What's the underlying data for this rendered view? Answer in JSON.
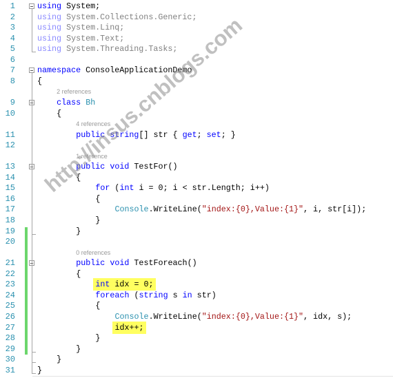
{
  "watermark": "http://insus.cnblogs.com",
  "colors": {
    "keyword": "#0000FF",
    "type": "#2B91AF",
    "string": "#A31515",
    "line_number": "#2B91AF",
    "change_bar": "#6CD66C",
    "highlight": "#FFFF60"
  },
  "rows": [
    {
      "ln": "1",
      "indent": 0,
      "fold": true,
      "seg": [
        [
          "using",
          "kw"
        ],
        [
          " System;",
          "pl"
        ]
      ]
    },
    {
      "ln": "2",
      "indent": 0,
      "seg": [
        [
          "using",
          "dkw"
        ],
        [
          " System.Collections.Generic;",
          "dpl"
        ]
      ]
    },
    {
      "ln": "3",
      "indent": 0,
      "seg": [
        [
          "using",
          "dkw"
        ],
        [
          " System.Linq;",
          "dpl"
        ]
      ]
    },
    {
      "ln": "4",
      "indent": 0,
      "seg": [
        [
          "using",
          "dkw"
        ],
        [
          " System.Text;",
          "dpl"
        ]
      ]
    },
    {
      "ln": "5",
      "indent": 0,
      "seg": [
        [
          "using",
          "dkw"
        ],
        [
          " System.Threading.Tasks;",
          "dpl"
        ]
      ]
    },
    {
      "ln": "6",
      "indent": 0,
      "seg": []
    },
    {
      "ln": "7",
      "indent": 0,
      "fold": true,
      "seg": [
        [
          "namespace",
          "kw"
        ],
        [
          " ConsoleApplicationDemo",
          "pl"
        ]
      ]
    },
    {
      "ln": "8",
      "indent": 0,
      "seg": [
        [
          "{",
          "pl"
        ]
      ]
    },
    {
      "ref": "2 references",
      "indent": 4
    },
    {
      "ln": "9",
      "indent": 4,
      "fold": true,
      "seg": [
        [
          "class",
          "kw"
        ],
        [
          " ",
          "pl"
        ],
        [
          "Bh",
          "ty"
        ]
      ]
    },
    {
      "ln": "10",
      "indent": 4,
      "seg": [
        [
          "{",
          "pl"
        ]
      ]
    },
    {
      "ref": "4 references",
      "indent": 8
    },
    {
      "ln": "11",
      "indent": 8,
      "seg": [
        [
          "public",
          "kw"
        ],
        [
          " ",
          "pl"
        ],
        [
          "string",
          "kw"
        ],
        [
          "[] str { ",
          "pl"
        ],
        [
          "get",
          "kw"
        ],
        [
          "; ",
          "pl"
        ],
        [
          "set",
          "kw"
        ],
        [
          "; }",
          "pl"
        ]
      ]
    },
    {
      "ln": "12",
      "indent": 0,
      "seg": []
    },
    {
      "ref": "1 reference",
      "indent": 8
    },
    {
      "ln": "13",
      "indent": 8,
      "fold": true,
      "seg": [
        [
          "public",
          "kw"
        ],
        [
          " ",
          "pl"
        ],
        [
          "void",
          "kw"
        ],
        [
          " TestFor()",
          "pl"
        ]
      ]
    },
    {
      "ln": "14",
      "indent": 8,
      "seg": [
        [
          "{",
          "pl"
        ]
      ]
    },
    {
      "ln": "15",
      "indent": 12,
      "seg": [
        [
          "for",
          "kw"
        ],
        [
          " (",
          "pl"
        ],
        [
          "int",
          "kw"
        ],
        [
          " i = 0; i < str.Length; i++)",
          "pl"
        ]
      ]
    },
    {
      "ln": "16",
      "indent": 12,
      "seg": [
        [
          "{",
          "pl"
        ]
      ]
    },
    {
      "ln": "17",
      "indent": 16,
      "seg": [
        [
          "Console",
          "ty"
        ],
        [
          ".WriteLine(",
          "pl"
        ],
        [
          "\"index:{0},Value:{1}\"",
          "st"
        ],
        [
          ", i, str[i]);",
          "pl"
        ]
      ]
    },
    {
      "ln": "18",
      "indent": 12,
      "seg": [
        [
          "}",
          "pl"
        ]
      ]
    },
    {
      "ln": "19",
      "indent": 8,
      "seg": [
        [
          "}",
          "pl"
        ]
      ]
    },
    {
      "ln": "20",
      "indent": 0,
      "seg": []
    },
    {
      "ref": "0 references",
      "indent": 8
    },
    {
      "ln": "21",
      "indent": 8,
      "fold": true,
      "seg": [
        [
          "public",
          "kw"
        ],
        [
          " ",
          "pl"
        ],
        [
          "void",
          "kw"
        ],
        [
          " TestForeach()",
          "pl"
        ]
      ]
    },
    {
      "ln": "22",
      "indent": 8,
      "seg": [
        [
          "{",
          "pl"
        ]
      ]
    },
    {
      "ln": "23",
      "indent": 12,
      "hl": true,
      "seg": [
        [
          "int",
          "kw"
        ],
        [
          " idx = 0;",
          "pl"
        ]
      ]
    },
    {
      "ln": "24",
      "indent": 12,
      "seg": [
        [
          "foreach",
          "kw"
        ],
        [
          " (",
          "pl"
        ],
        [
          "string",
          "kw"
        ],
        [
          " s ",
          "pl"
        ],
        [
          "in",
          "kw"
        ],
        [
          " str)",
          "pl"
        ]
      ]
    },
    {
      "ln": "25",
      "indent": 12,
      "seg": [
        [
          "{",
          "pl"
        ]
      ]
    },
    {
      "ln": "26",
      "indent": 16,
      "seg": [
        [
          "Console",
          "ty"
        ],
        [
          ".WriteLine(",
          "pl"
        ],
        [
          "\"index:{0},Value:{1}\"",
          "st"
        ],
        [
          ", idx, s);",
          "pl"
        ]
      ]
    },
    {
      "ln": "27",
      "indent": 16,
      "hl": true,
      "seg": [
        [
          "idx++;",
          "pl"
        ]
      ]
    },
    {
      "ln": "28",
      "indent": 12,
      "seg": [
        [
          "}",
          "pl"
        ]
      ]
    },
    {
      "ln": "29",
      "indent": 8,
      "seg": [
        [
          "}",
          "pl"
        ]
      ]
    },
    {
      "ln": "30",
      "indent": 4,
      "seg": [
        [
          "}",
          "pl"
        ]
      ]
    },
    {
      "ln": "31",
      "indent": 0,
      "seg": [
        [
          "}",
          "pl"
        ]
      ]
    }
  ]
}
